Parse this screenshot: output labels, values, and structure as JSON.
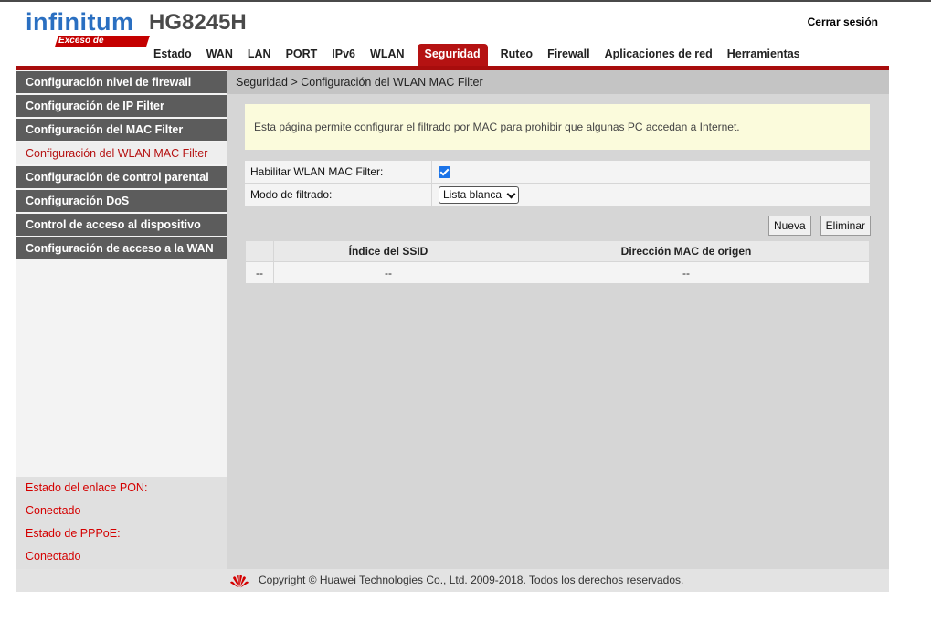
{
  "header": {
    "brand": "infinitum",
    "tagline": "Exceso de Velocidad",
    "model": "HG8245H",
    "logout_label": "Cerrar sesión"
  },
  "nav": {
    "items": [
      "Estado",
      "WAN",
      "LAN",
      "PORT",
      "IPv6",
      "WLAN",
      "Seguridad",
      "Ruteo",
      "Firewall",
      "Aplicaciones de red",
      "Herramientas"
    ],
    "active": "Seguridad"
  },
  "sidebar": {
    "items": [
      {
        "label": "Configuración nivel de firewall"
      },
      {
        "label": "Configuración de IP Filter"
      },
      {
        "label": "Configuración del MAC Filter"
      },
      {
        "label": "Configuración del WLAN MAC Filter"
      },
      {
        "label": "Configuración de control parental"
      },
      {
        "label": "Configuración DoS"
      },
      {
        "label": "Control de acceso al dispositivo"
      },
      {
        "label": "Configuración de acceso a la WAN"
      }
    ],
    "active_index": 3,
    "status": {
      "pon_label": "Estado del enlace PON:",
      "pon_value": "Conectado",
      "pppoe_label": "Estado de PPPoE:",
      "pppoe_value": "Conectado"
    }
  },
  "main": {
    "breadcrumb": "Seguridad > Configuración del WLAN MAC Filter",
    "info": "Esta página permite configurar el filtrado por MAC para prohibir que algunas PC accedan a Internet.",
    "form": {
      "enable_label": "Habilitar WLAN MAC Filter:",
      "enable_checked": true,
      "mode_label": "Modo de filtrado:",
      "mode_value": "Lista blanca"
    },
    "buttons": {
      "new": "Nueva",
      "delete": "Eliminar"
    },
    "table": {
      "headers": [
        "",
        "Índice del SSID",
        "Dirección MAC de origen"
      ],
      "rows": [
        [
          "--",
          "--",
          "--"
        ]
      ]
    }
  },
  "footer": {
    "copyright": "Copyright © Huawei Technologies Co., Ltd. 2009-2018. Todos los derechos reservados."
  },
  "colors": {
    "brand_blue": "#2a6fc1",
    "accent_red": "#b51212",
    "sidebar_gray": "#5c5c5c",
    "status_red": "#d40000"
  }
}
